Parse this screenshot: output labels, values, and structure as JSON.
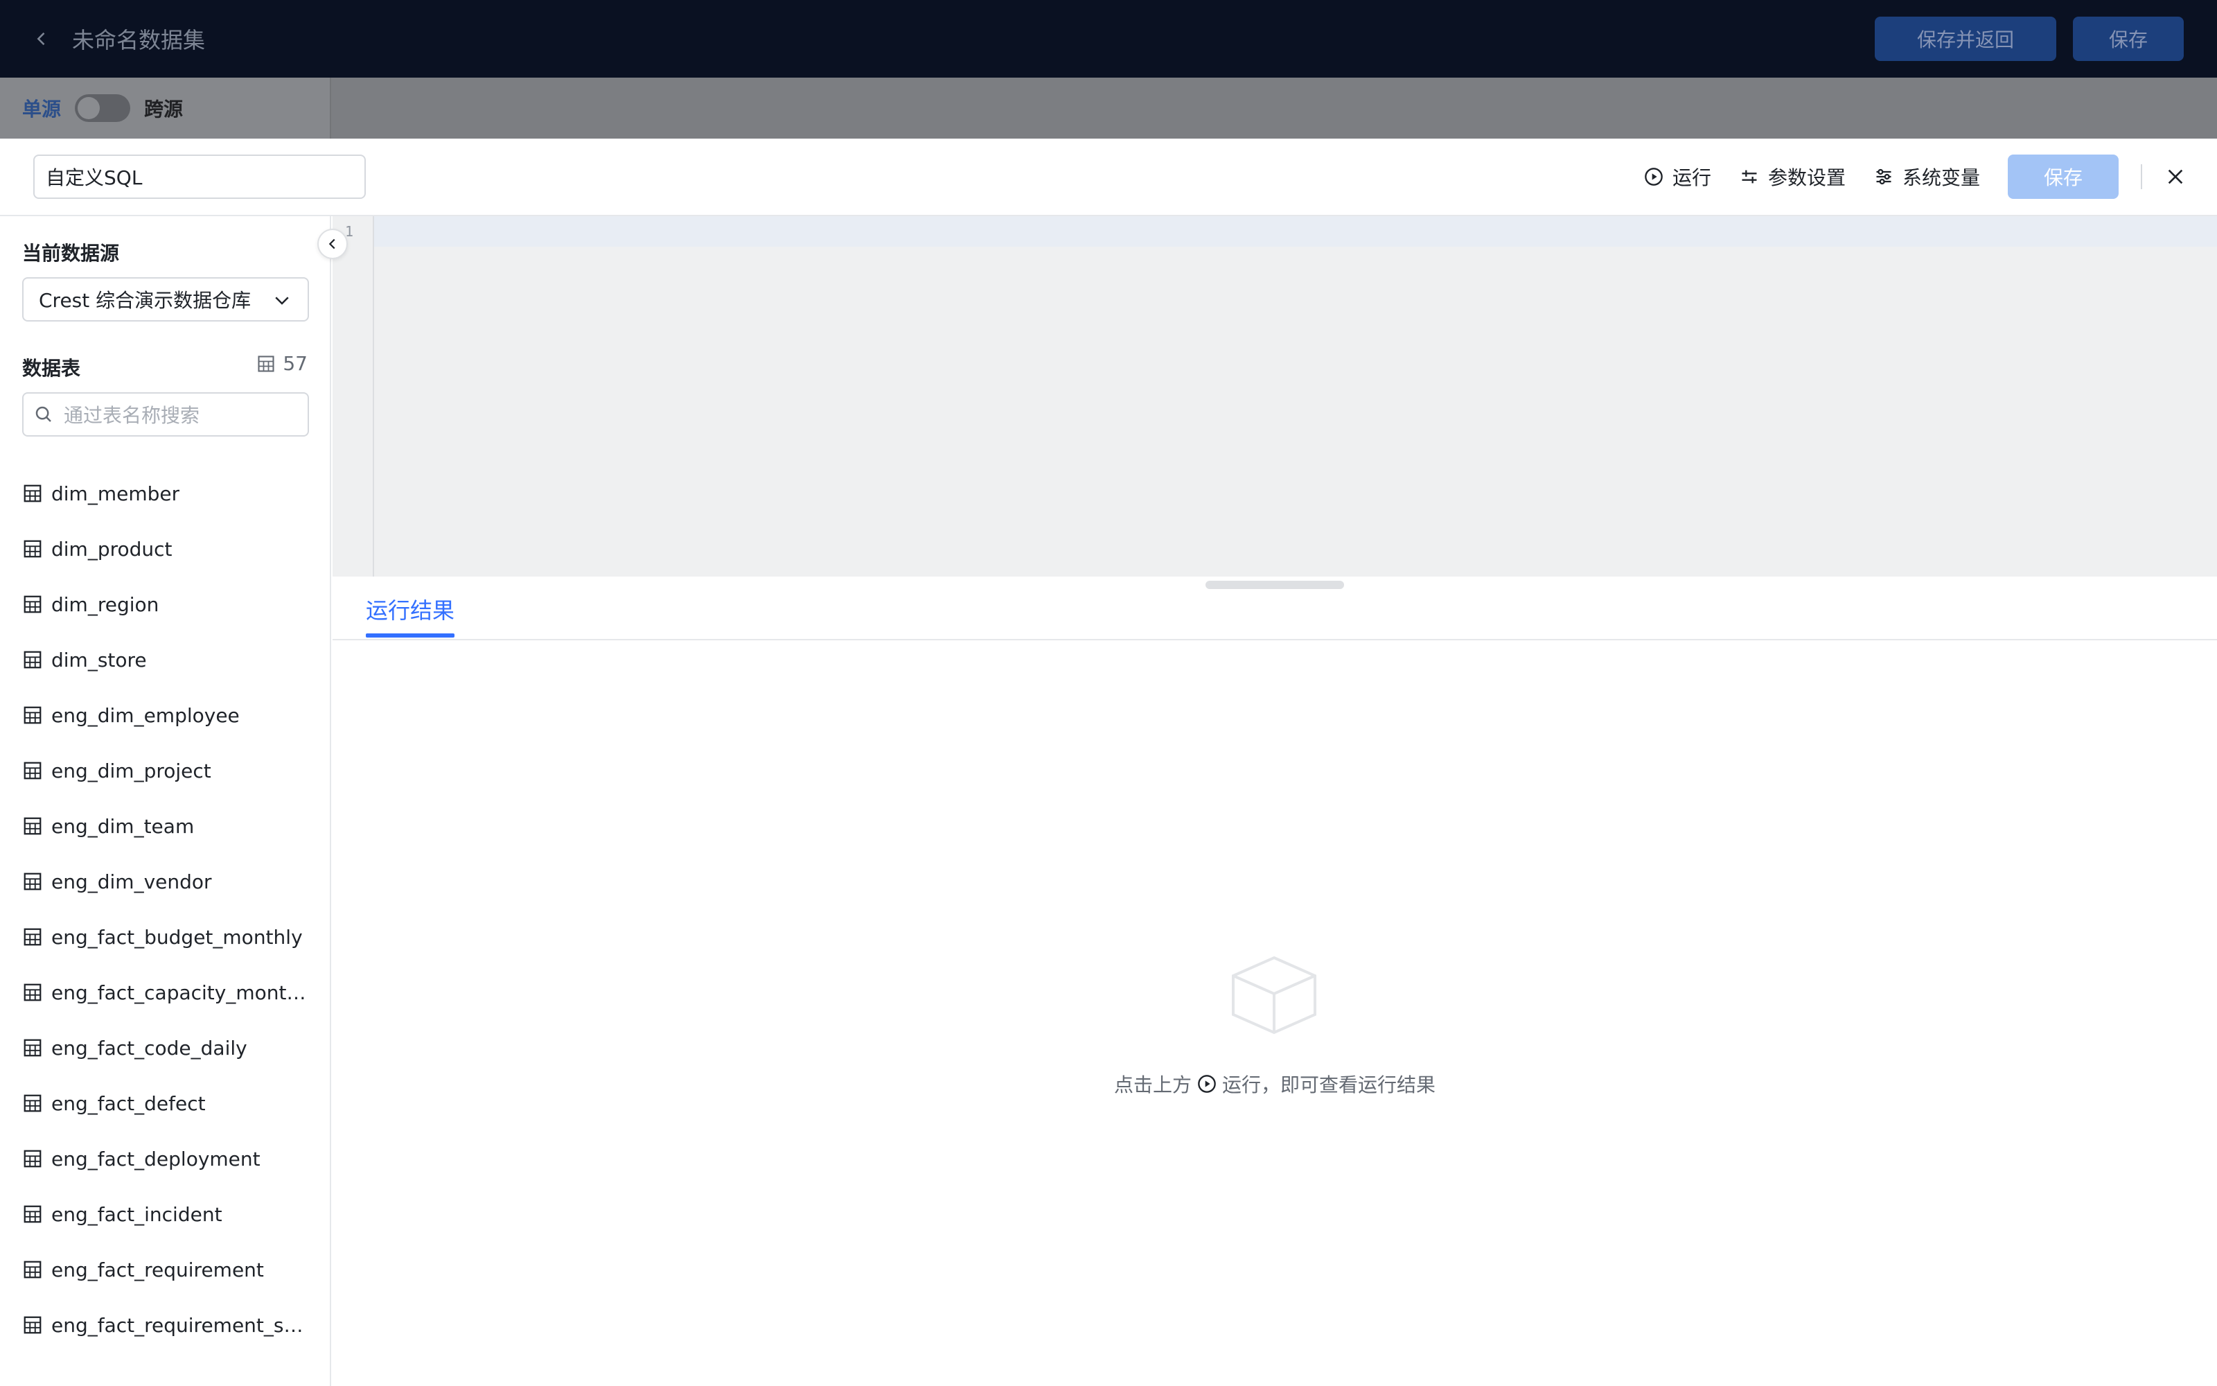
{
  "app": {
    "title": "未命名数据集",
    "save_back_label": "保存并返回",
    "save_label": "保存"
  },
  "source_mode": {
    "single_label": "单源",
    "cross_label": "跨源",
    "cross_enabled": false
  },
  "drawer": {
    "name_value": "自定义SQL",
    "actions": {
      "run": "运行",
      "params": "参数设置",
      "sys_vars": "系统变量",
      "save": "保存"
    }
  },
  "sidebar": {
    "datasource_title": "当前数据源",
    "datasource_value": "Crest 综合演示数据仓库",
    "tables_title": "数据表",
    "table_count": "57",
    "search_placeholder": "通过表名称搜索",
    "tables": [
      "dim_member",
      "dim_product",
      "dim_region",
      "dim_store",
      "eng_dim_employee",
      "eng_dim_project",
      "eng_dim_team",
      "eng_dim_vendor",
      "eng_fact_budget_monthly",
      "eng_fact_capacity_monthly",
      "eng_fact_code_daily",
      "eng_fact_defect",
      "eng_fact_deployment",
      "eng_fact_incident",
      "eng_fact_requirement",
      "eng_fact_requirement_snapshot"
    ]
  },
  "editor": {
    "line_numbers": [
      "1"
    ]
  },
  "results": {
    "tab_label": "运行结果",
    "empty_prefix": "点击上方",
    "empty_suffix": "运行，即可查看运行结果"
  }
}
